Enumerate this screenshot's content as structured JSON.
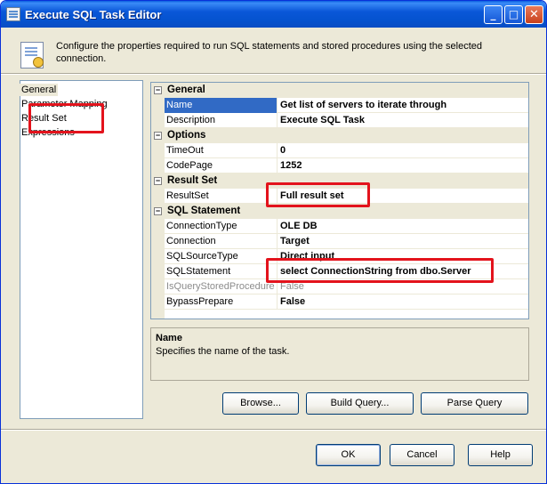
{
  "window": {
    "title": "Execute SQL Task Editor",
    "controls": {
      "minimize": "_",
      "maximize": "□",
      "close": "✕"
    }
  },
  "header": {
    "description": "Configure the properties required to run SQL statements and stored procedures using the selected connection.",
    "icon": "task-editor-icon"
  },
  "nav": {
    "items": [
      {
        "label": "General",
        "selected": true
      },
      {
        "label": "Parameter Mapping",
        "selected": false
      },
      {
        "label": "Result Set",
        "selected": false,
        "highlighted": true
      },
      {
        "label": "Expressions",
        "selected": false
      }
    ]
  },
  "grid": {
    "categories": [
      {
        "label": "General",
        "expander": "⊟",
        "properties": [
          {
            "name": "Name",
            "value": "Get list of servers to iterate through",
            "selected": true
          },
          {
            "name": "Description",
            "value": "Execute SQL Task"
          }
        ]
      },
      {
        "label": "Options",
        "expander": "⊟",
        "properties": [
          {
            "name": "TimeOut",
            "value": "0"
          },
          {
            "name": "CodePage",
            "value": "1252"
          }
        ]
      },
      {
        "label": "Result Set",
        "expander": "⊟",
        "properties": [
          {
            "name": "ResultSet",
            "value": "Full result set",
            "highlighted": true
          }
        ]
      },
      {
        "label": "SQL Statement",
        "expander": "⊟",
        "properties": [
          {
            "name": "ConnectionType",
            "value": "OLE DB"
          },
          {
            "name": "Connection",
            "value": "Target"
          },
          {
            "name": "SQLSourceType",
            "value": "Direct input"
          },
          {
            "name": "SQLStatement",
            "value": "select ConnectionString from dbo.Server",
            "highlighted": true
          },
          {
            "name": "IsQueryStoredProcedure",
            "value": "False",
            "disabled": true
          },
          {
            "name": "BypassPrepare",
            "value": "False"
          }
        ]
      }
    ]
  },
  "description_panel": {
    "title": "Name",
    "text": "Specifies the name of the task."
  },
  "buttons": {
    "browse": "Browse...",
    "build_query": "Build Query...",
    "parse_query": "Parse Query",
    "ok": "OK",
    "cancel": "Cancel",
    "help": "Help"
  },
  "colors": {
    "titlebar": "#0553d0",
    "selection": "#316ac5",
    "highlight_box": "#e3131c",
    "dialog_bg": "#ece9d8"
  }
}
